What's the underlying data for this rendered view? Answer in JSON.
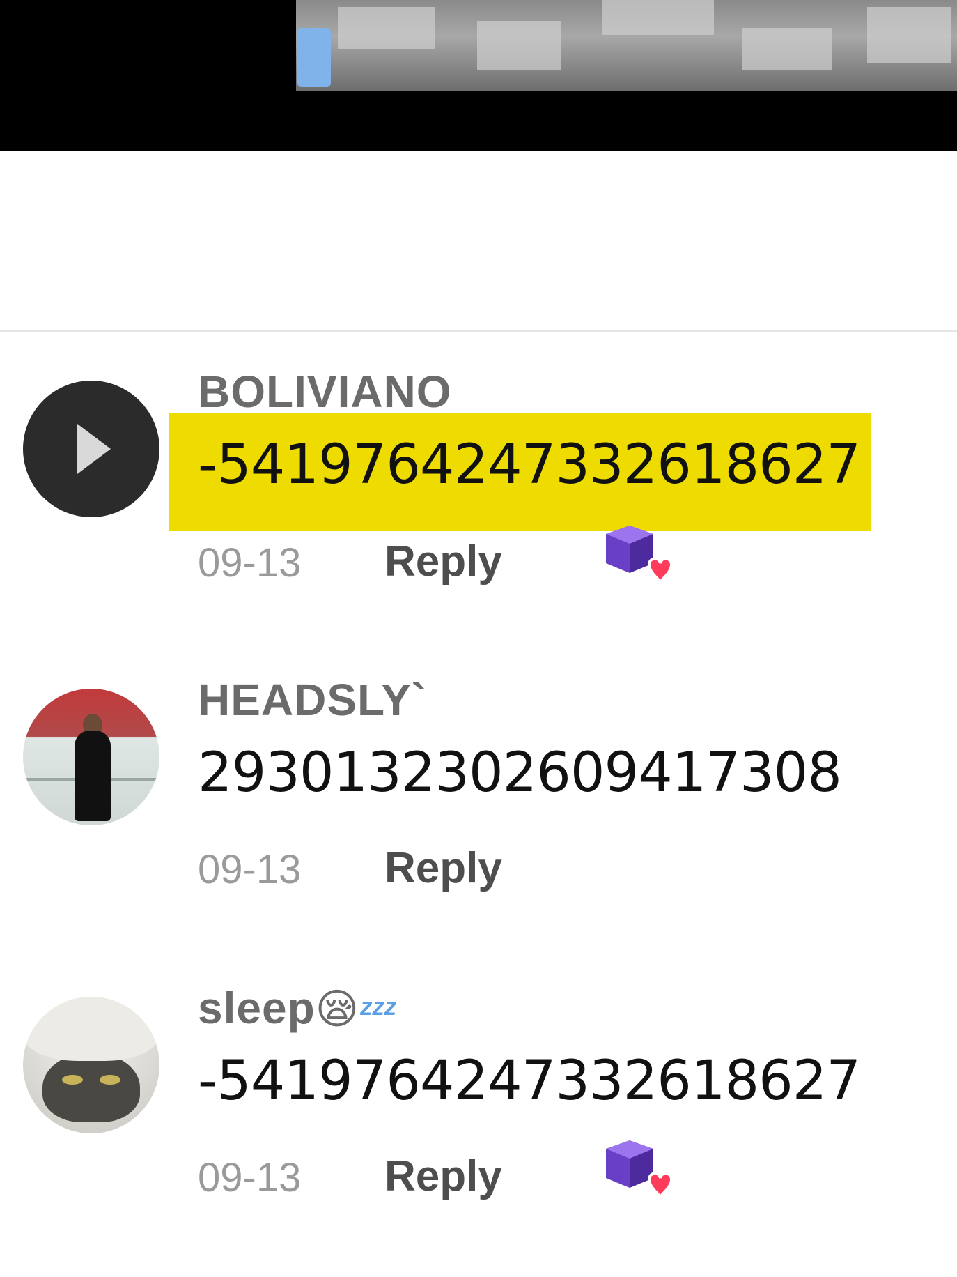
{
  "colors": {
    "highlight": "#eedc00",
    "username": "#6b6b6b",
    "date": "#9a9a9a",
    "reply": "#4e4e4e"
  },
  "comments": [
    {
      "username": "BOLIVIANO",
      "text": "-5419764247332618627",
      "date": "09-13",
      "reply_label": "Reply",
      "avatar_icon": "play-icon",
      "highlighted": true,
      "reaction_icon": "purple-cube-heart-icon"
    },
    {
      "username": "HEADSLY`",
      "text": "2930132302609417308",
      "date": "09-13",
      "reply_label": "Reply",
      "avatar_icon": "person-photo",
      "highlighted": false
    },
    {
      "username": "sleep",
      "username_emoji": "😪",
      "username_suffix": "ᶻᶻᶻ",
      "text": "-5419764247332618627",
      "date": "09-13",
      "reply_label": "Reply",
      "avatar_icon": "cat-photo",
      "highlighted": false,
      "reaction_icon": "purple-cube-heart-icon"
    }
  ]
}
